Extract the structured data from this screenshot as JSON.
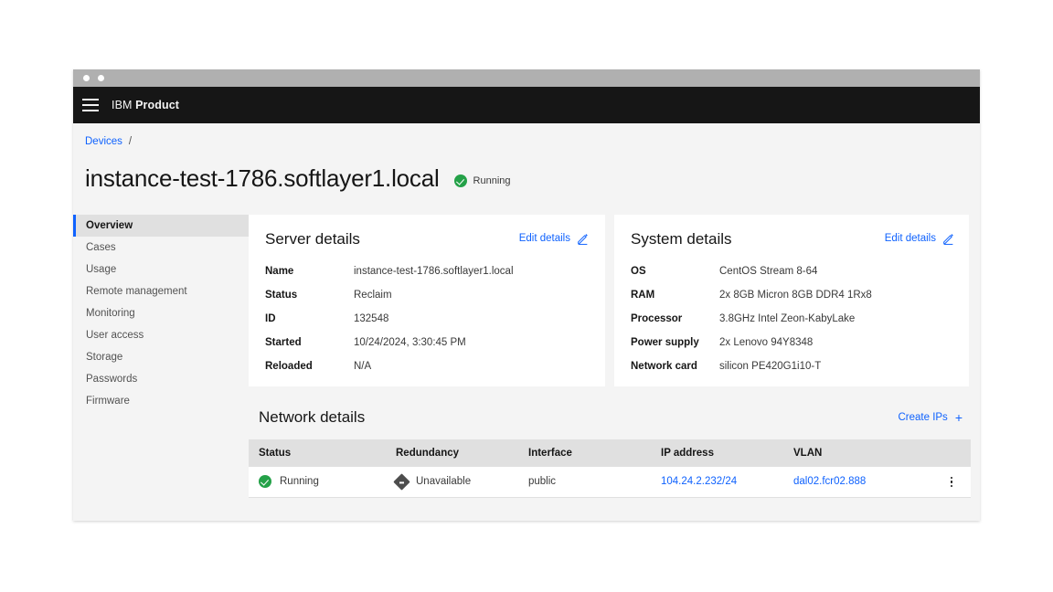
{
  "window": {
    "title_dots": 2
  },
  "header": {
    "menu_icon": "hamburger-icon",
    "brand_prefix": "IBM",
    "brand_name": "Product"
  },
  "breadcrumb": {
    "items": [
      {
        "label": "Devices",
        "link": true
      }
    ],
    "separator": "/"
  },
  "page": {
    "title": "instance-test-1786.softlayer1.local",
    "status": {
      "label": "Running",
      "icon": "check-circle-icon",
      "color": "#24a148"
    }
  },
  "sidebar": {
    "items": [
      {
        "label": "Overview",
        "active": true
      },
      {
        "label": "Cases",
        "active": false
      },
      {
        "label": "Usage",
        "active": false
      },
      {
        "label": "Remote management",
        "active": false
      },
      {
        "label": "Monitoring",
        "active": false
      },
      {
        "label": "User access",
        "active": false
      },
      {
        "label": "Storage",
        "active": false
      },
      {
        "label": "Passwords",
        "active": false
      },
      {
        "label": "Firmware",
        "active": false
      }
    ],
    "active_accent": "#0f62fe"
  },
  "server_details": {
    "title": "Server details",
    "edit_label": "Edit details",
    "edit_icon": "pencil-icon",
    "rows": [
      {
        "key": "Name",
        "value": "instance-test-1786.softlayer1.local"
      },
      {
        "key": "Status",
        "value": "Reclaim"
      },
      {
        "key": "ID",
        "value": "132548"
      },
      {
        "key": "Started",
        "value": "10/24/2024, 3:30:45 PM"
      },
      {
        "key": "Reloaded",
        "value": "N/A"
      }
    ]
  },
  "system_details": {
    "title": "System details",
    "edit_label": "Edit details",
    "edit_icon": "pencil-icon",
    "rows": [
      {
        "key": "OS",
        "value": "CentOS Stream 8-64"
      },
      {
        "key": "RAM",
        "value": "2x 8GB Micron 8GB DDR4 1Rx8"
      },
      {
        "key": "Processor",
        "value": "3.8GHz Intel Zeon-KabyLake"
      },
      {
        "key": "Power supply",
        "value": "2x Lenovo 94Y8348"
      },
      {
        "key": "Network card",
        "value": "silicon PE420G1i10-T"
      }
    ]
  },
  "network_details": {
    "title": "Network details",
    "create_label": "Create IPs",
    "create_icon": "plus-icon",
    "columns": [
      "Status",
      "Redundancy",
      "Interface",
      "IP address",
      "VLAN"
    ],
    "rows": [
      {
        "status": "Running",
        "status_icon": "check-circle-icon",
        "redundancy": "Unavailable",
        "redundancy_icon": "diamond-warning-icon",
        "interface": "public",
        "ip_address": "104.24.2.232/24",
        "vlan": "dal02.fcr02.888",
        "menu_icon": "overflow-menu-icon"
      }
    ]
  },
  "colors": {
    "link": "#0f62fe",
    "header_bg": "#161616",
    "page_bg": "#f4f4f4",
    "card_bg": "#ffffff",
    "success": "#24a148"
  }
}
